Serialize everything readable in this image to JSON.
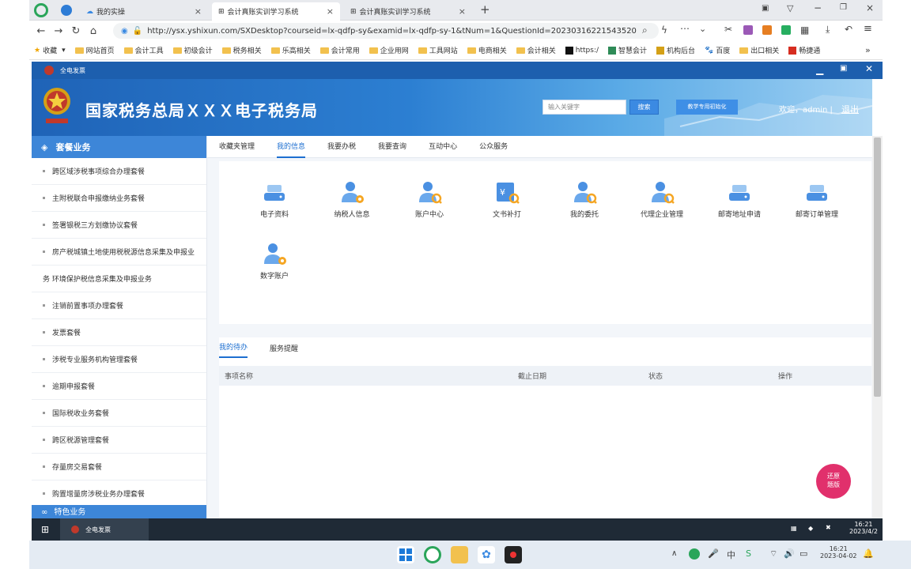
{
  "browser": {
    "tabs": [
      {
        "label": "我的实操",
        "active": false
      },
      {
        "label": "会计真账实训学习系统",
        "active": true
      },
      {
        "label": "会计真账实训学习系统",
        "active": false
      }
    ],
    "url": "http://ysx.yshixun.com/SXDesktop?courseid=lx-qdfp-sy&examid=lx-qdfp-sy-1&tNum=1&QuestionId=20230316221543520",
    "bookmarks": [
      "收藏",
      "网站首页",
      "会计工具",
      "初级会计",
      "税务相关",
      "乐高相关",
      "会计常用",
      "企业用网",
      "工具网站",
      "电商相关",
      "会计相关",
      "https:/",
      "智慧会计",
      "机构后台",
      "百度",
      "出口相关",
      "畅捷通"
    ]
  },
  "app": {
    "window_title": "全电发票",
    "site_title": "国家税务总局ＸＸＸ电子税务局",
    "search_placeholder": "输入关键字",
    "search_button": "搜索",
    "init_button": "教学专用初始化",
    "welcome": "欢迎，admin |",
    "logout": "退出"
  },
  "sidebar": {
    "header": "套餐业务",
    "items": [
      "跨区域涉税事项综合办理套餐",
      "主附税联合申报缴纳业务套餐",
      "签署银税三方划缴协议套餐",
      "房产税城镇土地使用税税源信息采集及申报业",
      "务 环境保护税信息采集及申报业务",
      "注销前置事项办理套餐",
      "发票套餐",
      "涉税专业服务机构管理套餐",
      "逾期申报套餐",
      "国际税收业务套餐",
      "跨区税源管理套餐",
      "存量房交易套餐",
      "购置增量房涉税业务办理套餐"
    ],
    "footer": "特色业务"
  },
  "topnav": [
    "收藏夹管理",
    "我的信息",
    "我要办税",
    "我要查询",
    "互动中心",
    "公众服务"
  ],
  "topnav_active": 1,
  "icons": [
    {
      "label": "电子资料",
      "icon": "drive-icon"
    },
    {
      "label": "纳税人信息",
      "icon": "person-gear-icon"
    },
    {
      "label": "账户中心",
      "icon": "person-search-icon"
    },
    {
      "label": "文书补打",
      "icon": "document-yuan-icon"
    },
    {
      "label": "我的委托",
      "icon": "person-search-icon"
    },
    {
      "label": "代理企业管理",
      "icon": "person-search-icon"
    },
    {
      "label": "邮寄地址申请",
      "icon": "drive-icon"
    },
    {
      "label": "邮寄订单管理",
      "icon": "drive-icon"
    },
    {
      "label": "数字账户",
      "icon": "person-gear-icon"
    }
  ],
  "tasks": {
    "tabs": [
      "我的待办",
      "服务提醒"
    ],
    "columns": [
      "事项名称",
      "截止日期",
      "状态",
      "操作"
    ]
  },
  "fab": {
    "line1": "还原",
    "line2": "题版"
  },
  "app_taskbar": {
    "item": "全电发票",
    "time": "16:21",
    "date": "2023/4/2"
  },
  "os_taskbar": {
    "time": "16:21",
    "date": "2023-04-02"
  }
}
